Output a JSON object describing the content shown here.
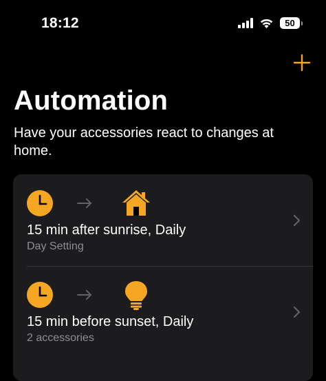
{
  "status_bar": {
    "time": "18:12",
    "battery_level": "50",
    "icons": [
      "cellular-signal-icon",
      "wifi-icon",
      "battery-icon"
    ]
  },
  "header": {
    "add_icon": "plus-icon",
    "title": "Automation",
    "subtitle": "Have your accessories react to changes at home."
  },
  "colors": {
    "accent": "#f5a623",
    "background": "#000000",
    "card": "#1c1c1e",
    "secondary_text": "#8e8e93"
  },
  "automations": [
    {
      "trigger_icon": "clock-icon",
      "target_icon": "home-icon",
      "title": "15 min after sunrise, Daily",
      "detail": "Day Setting"
    },
    {
      "trigger_icon": "clock-icon",
      "target_icon": "lightbulb-icon",
      "title": "15 min before sunset, Daily",
      "detail": "2 accessories"
    }
  ]
}
